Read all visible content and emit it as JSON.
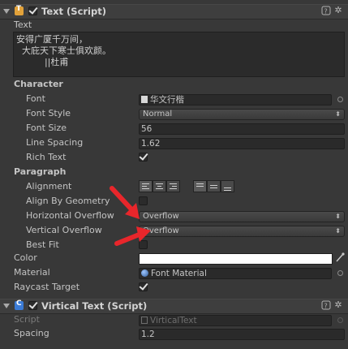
{
  "text_component": {
    "header_title": "Text (Script)",
    "text_label": "Text",
    "text_value": "安得广厦千万间，\n  大庇天下寒士俱欢颜。\n          ||杜甫",
    "character_section": "Character",
    "font_label": "Font",
    "font_value": "华文行楷",
    "font_style_label": "Font Style",
    "font_style_value": "Normal",
    "font_size_label": "Font Size",
    "font_size_value": "56",
    "line_spacing_label": "Line Spacing",
    "line_spacing_value": "1.62",
    "rich_text_label": "Rich Text",
    "rich_text_checked": true,
    "paragraph_section": "Paragraph",
    "alignment_label": "Alignment",
    "align_by_geometry_label": "Align By Geometry",
    "align_by_geometry_checked": false,
    "horizontal_overflow_label": "Horizontal Overflow",
    "horizontal_overflow_value": "Overflow",
    "vertical_overflow_label": "Vertical Overflow",
    "vertical_overflow_value": "Overflow",
    "best_fit_label": "Best Fit",
    "best_fit_checked": false,
    "color_label": "Color",
    "color_value": "#ffffff",
    "material_label": "Material",
    "material_value": "Font Material",
    "raycast_label": "Raycast Target",
    "raycast_checked": true
  },
  "vertical_component": {
    "header_title": "Virtical Text (Script)",
    "script_label": "Script",
    "script_value": "VirticalText",
    "spacing_label": "Spacing",
    "spacing_value": "1.2"
  },
  "colors": {
    "background": "#383838",
    "annotation_arrow": "#e8262b"
  },
  "icons": [
    "foldout-arrow-icon",
    "text-component-icon",
    "help-icon",
    "settings-gear-icon",
    "font-asset-icon",
    "material-sphere-icon",
    "eyedropper-icon",
    "object-picker-icon"
  ]
}
